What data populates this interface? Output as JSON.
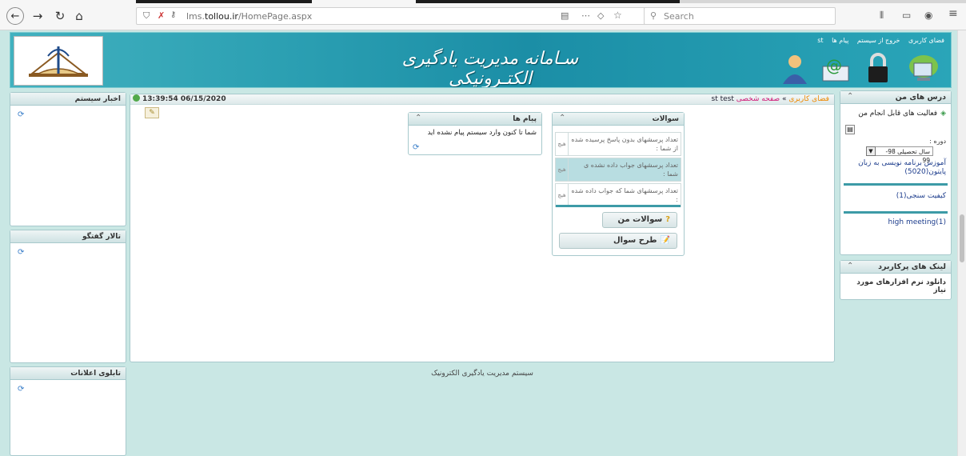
{
  "browser": {
    "url_prefix": "lms.",
    "url_domain": "tollou.ir",
    "url_path": "/HomePage.aspx",
    "search_placeholder": "Search"
  },
  "header": {
    "title": "سـامانه مدیریت یادگیری الکتـرونیکی",
    "links": [
      "فضای کاربری",
      "خروج از سیستم",
      "پیام ها",
      "st"
    ]
  },
  "center": {
    "datetime": "13:39:54 06/15/2020",
    "breadcrumb": {
      "part1": "فضای کاربری",
      "sep": " » ",
      "part2": "صفحه شخصی",
      "user": "st test"
    },
    "questions": {
      "title": "سوالات",
      "rows": [
        {
          "text": "تعداد پرسشهای بدون پاسخ پرسیده شده از شما :",
          "count": "هیچ"
        },
        {
          "text": "تعداد پرسشهای جواب داده نشده ی شما :",
          "count": "هیچ"
        },
        {
          "text": "تعداد پرسشهای شما که جواب داده شده :",
          "count": "هیچ"
        }
      ],
      "my_questions": "سوالات من",
      "ask_question": "طرح سوال"
    },
    "messages": {
      "title": "پیام ها",
      "text": "شما تا کنون وارد سیستم پیام نشده اید"
    }
  },
  "right": {
    "courses": {
      "title": "درس های من",
      "activities": "فعالیت های قابل انجام من",
      "term_label": "دوره :",
      "term_select": "سال تحصیلی 98-99",
      "course_name": "آموزش برنامه نویسی به زبان پایتون(5020)",
      "quality": "کیفیت سنجی(1)",
      "meeting": "high meeting(1)"
    },
    "links": {
      "title": "لینک های پرکاربرد",
      "item": "دانلود نرم افزارهای مورد نیاز"
    }
  },
  "left": {
    "news": "اخبار سیستم",
    "forum": "تالار گفتگو",
    "board": "تابلوی اعلانات"
  },
  "footer": "سیستم مدیریت یادگیری الکترونیک"
}
